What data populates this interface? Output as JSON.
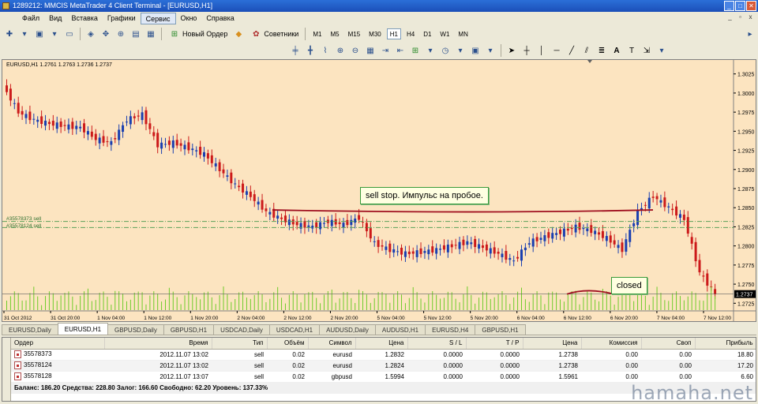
{
  "window": {
    "title": "1289212: MMCIS MetaTrader 4 Client Terminal - [EURUSD,H1]",
    "controls": [
      "_",
      "□",
      "✕"
    ]
  },
  "menu": {
    "items": [
      "Файл",
      "Вид",
      "Вставка",
      "Графики",
      "Сервис",
      "Окно",
      "Справка"
    ],
    "active_index": 4,
    "mdi_controls": [
      "_",
      "▫",
      "x"
    ]
  },
  "toolbar": {
    "new_order": "Новый Ордер",
    "advisors": "Советники",
    "timeframes": [
      "M1",
      "M5",
      "M15",
      "M30",
      "H1",
      "H4",
      "D1",
      "W1",
      "MN"
    ],
    "active_timeframe": "H1"
  },
  "chart": {
    "header": "EURUSD,H1  1.2761 1.2763 1.2736 1.2737",
    "order_labels": [
      "#35578373 sell",
      "#35578124 sell"
    ],
    "callout_sell": "sell stop. Импульс на пробое.",
    "callout_closed": "closed",
    "current_price": "1.2737",
    "colors": {
      "bull": "#1a3fb0",
      "bear": "#cc1a1a",
      "volume": "#6ecb2a",
      "line": "#a01020",
      "order": "#5aa05a"
    }
  },
  "chart_data": {
    "type": "candlestick",
    "title": "EURUSD,H1",
    "ylim": [
      1.2715,
      1.3035
    ],
    "y_ticks": [
      "1.3025",
      "1.3000",
      "1.2975",
      "1.2950",
      "1.2925",
      "1.2900",
      "1.2875",
      "1.2850",
      "1.2825",
      "1.2800",
      "1.2775",
      "1.2750",
      "1.2725"
    ],
    "x_ticks": [
      "31 Oct 2012",
      "31 Oct 20:00",
      "1 Nov 04:00",
      "1 Nov 12:00",
      "1 Nov 20:00",
      "2 Nov 04:00",
      "2 Nov 12:00",
      "2 Nov 20:00",
      "5 Nov 04:00",
      "5 Nov 12:00",
      "5 Nov 20:00",
      "6 Nov 04:00",
      "6 Nov 12:00",
      "6 Nov 20:00",
      "7 Nov 04:00",
      "7 Nov 12:00"
    ],
    "close_path": [
      1.301,
      1.2975,
      1.2965,
      1.296,
      1.2957,
      1.2955,
      1.294,
      1.2935,
      1.2965,
      1.2972,
      1.2932,
      1.2935,
      1.2928,
      1.292,
      1.29,
      1.288,
      1.2865,
      1.2845,
      1.2835,
      1.2828,
      1.2825,
      1.2832,
      1.2828,
      1.2837,
      1.2803,
      1.2795,
      1.279,
      1.2792,
      1.2795,
      1.28,
      1.2805,
      1.2798,
      1.279,
      1.278,
      1.2805,
      1.2812,
      1.2818,
      1.2825,
      1.282,
      1.281,
      1.2795,
      1.2845,
      1.2865,
      1.285,
      1.2835,
      1.2765,
      1.2737
    ],
    "order_levels": [
      1.2832,
      1.2824
    ],
    "signal_line": 1.2845,
    "current_price": 1.2737
  },
  "tabs": {
    "items": [
      "EURUSD,Daily",
      "EURUSD,H1",
      "GBPUSD,Daily",
      "GBPUSD,H1",
      "USDCAD,Daily",
      "USDCAD,H1",
      "AUDUSD,Daily",
      "AUDUSD,H1",
      "EURUSD,H4",
      "GBPUSD,H1"
    ],
    "active_index": 1
  },
  "terminal": {
    "columns": [
      "Ордер",
      "Время",
      "Тип",
      "Объём",
      "Символ",
      "Цена",
      "S / L",
      "T / P",
      "Цена",
      "Комиссия",
      "Своп",
      "Прибыль"
    ],
    "rows": [
      [
        "35578373",
        "2012.11.07 13:02",
        "sell",
        "0.02",
        "eurusd",
        "1.2832",
        "0.0000",
        "0.0000",
        "1.2738",
        "0.00",
        "0.00",
        "18.80"
      ],
      [
        "35578124",
        "2012.11.07 13:02",
        "sell",
        "0.02",
        "eurusd",
        "1.2824",
        "0.0000",
        "0.0000",
        "1.2738",
        "0.00",
        "0.00",
        "17.20"
      ],
      [
        "35578128",
        "2012.11.07 13:07",
        "sell",
        "0.02",
        "gbpusd",
        "1.5994",
        "0.0000",
        "0.0000",
        "1.5961",
        "0.00",
        "0.00",
        "6.60"
      ]
    ],
    "balance": "Баланс: 186.20  Средства: 228.80  Залог: 166.60  Свободно: 62.20  Уровень: 137.33%"
  },
  "watermark": "hamaha.net"
}
